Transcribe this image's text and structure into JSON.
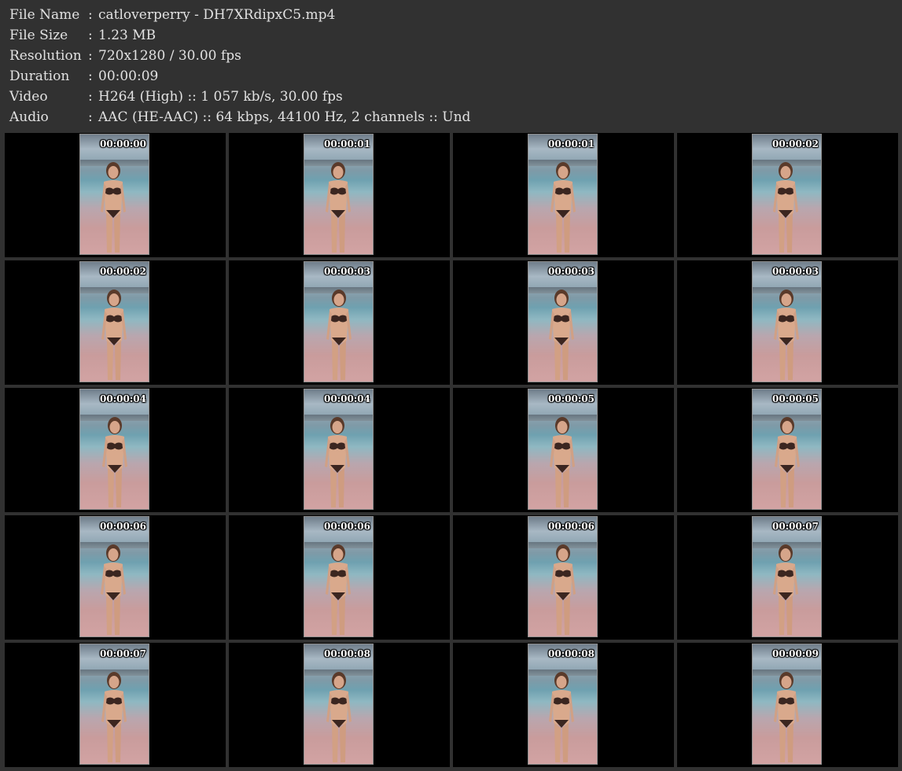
{
  "info": [
    {
      "label": "File Name",
      "sep": ":",
      "value": "catloverperry - DH7XRdipxC5.mp4"
    },
    {
      "label": "File Size",
      "sep": ":",
      "value": "1.23 MB"
    },
    {
      "label": "Resolution",
      "sep": ":",
      "value": "720x1280 / 30.00 fps"
    },
    {
      "label": "Duration",
      "sep": ":",
      "value": "00:00:09"
    },
    {
      "label": "Video",
      "sep": ":",
      "value": "H264 (High) :: 1 057 kb/s, 30.00 fps"
    },
    {
      "label": "Audio",
      "sep": ":",
      "value": "AAC (HE-AAC) :: 64 kbps, 44100 Hz, 2 channels :: Und"
    }
  ],
  "thumbnails": [
    {
      "timestamp": "00:00:00"
    },
    {
      "timestamp": "00:00:01"
    },
    {
      "timestamp": "00:00:01"
    },
    {
      "timestamp": "00:00:02"
    },
    {
      "timestamp": "00:00:02"
    },
    {
      "timestamp": "00:00:03"
    },
    {
      "timestamp": "00:00:03"
    },
    {
      "timestamp": "00:00:03"
    },
    {
      "timestamp": "00:00:04"
    },
    {
      "timestamp": "00:00:04"
    },
    {
      "timestamp": "00:00:05"
    },
    {
      "timestamp": "00:00:05"
    },
    {
      "timestamp": "00:00:06"
    },
    {
      "timestamp": "00:00:06"
    },
    {
      "timestamp": "00:00:06"
    },
    {
      "timestamp": "00:00:07"
    },
    {
      "timestamp": "00:00:07"
    },
    {
      "timestamp": "00:00:08"
    },
    {
      "timestamp": "00:00:08"
    },
    {
      "timestamp": "00:00:09"
    }
  ]
}
